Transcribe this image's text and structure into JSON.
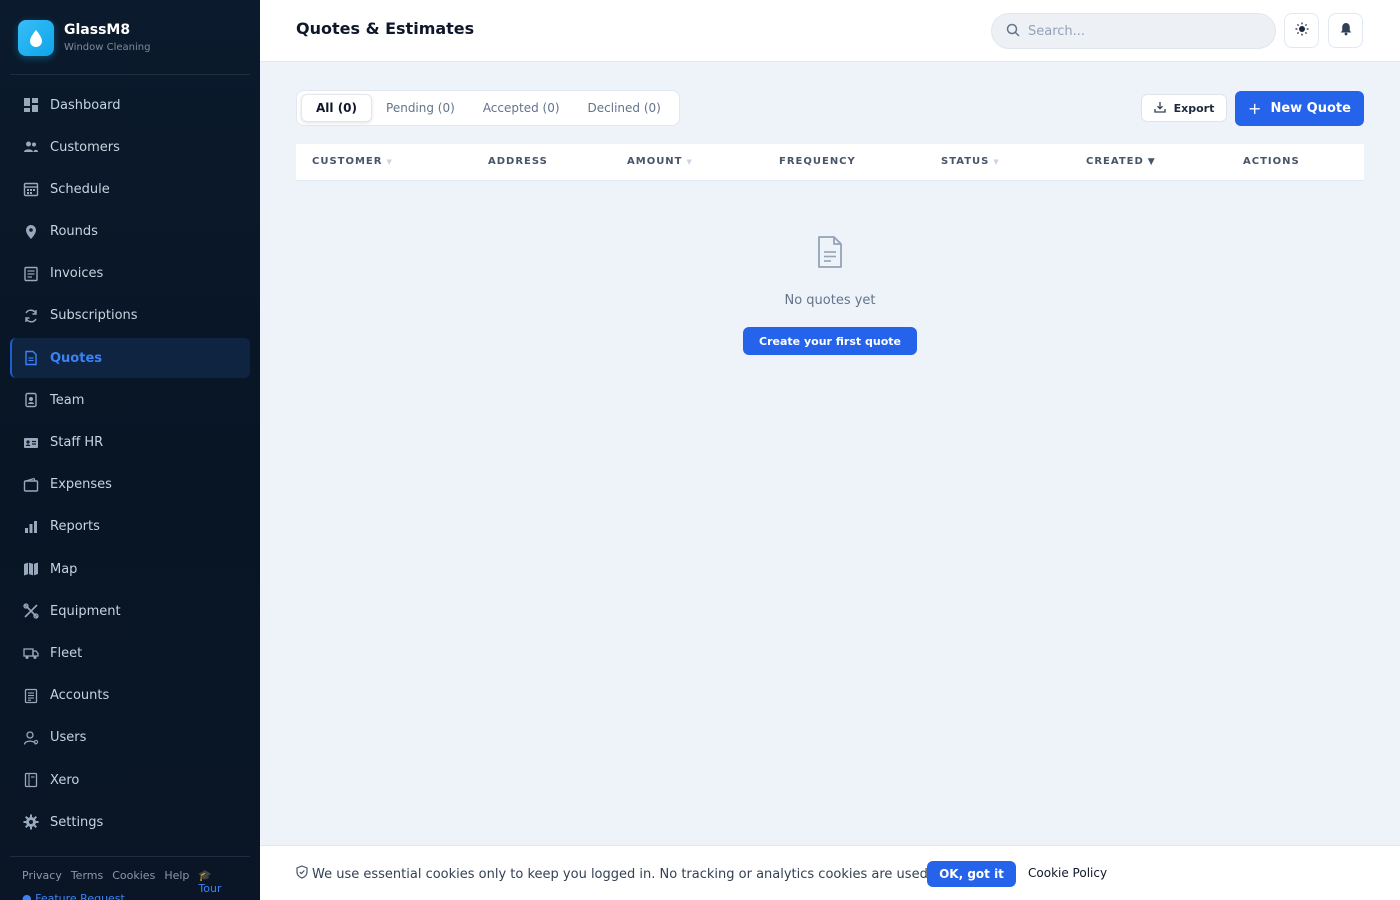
{
  "brand": {
    "name": "GlassM8",
    "subtitle": "Window Cleaning"
  },
  "sidebar": {
    "items": [
      {
        "label": "Dashboard",
        "icon": "dashboard-icon"
      },
      {
        "label": "Customers",
        "icon": "customers-icon"
      },
      {
        "label": "Schedule",
        "icon": "calendar-icon"
      },
      {
        "label": "Rounds",
        "icon": "map-pin-icon"
      },
      {
        "label": "Invoices",
        "icon": "invoice-icon"
      },
      {
        "label": "Subscriptions",
        "icon": "refresh-icon"
      },
      {
        "label": "Quotes",
        "icon": "document-icon",
        "active": true
      },
      {
        "label": "Team",
        "icon": "id-badge-icon"
      },
      {
        "label": "Staff HR",
        "icon": "id-card-icon"
      },
      {
        "label": "Expenses",
        "icon": "wallet-icon"
      },
      {
        "label": "Reports",
        "icon": "bar-chart-icon"
      },
      {
        "label": "Map",
        "icon": "map-icon"
      },
      {
        "label": "Equipment",
        "icon": "tools-icon"
      },
      {
        "label": "Fleet",
        "icon": "truck-icon"
      },
      {
        "label": "Accounts",
        "icon": "ledger-icon"
      },
      {
        "label": "Users",
        "icon": "user-icon"
      },
      {
        "label": "Xero",
        "icon": "book-icon"
      },
      {
        "label": "Settings",
        "icon": "gear-icon"
      }
    ],
    "footer_links": [
      "Privacy",
      "Terms",
      "Cookies",
      "Help"
    ],
    "tour_label": "Tour",
    "feature_request_label": "Feature Request"
  },
  "header": {
    "title": "Quotes & Estimates",
    "search_placeholder": "Search..."
  },
  "tabs": [
    {
      "label": "All (0)",
      "active": true
    },
    {
      "label": "Pending (0)"
    },
    {
      "label": "Accepted (0)"
    },
    {
      "label": "Declined (0)"
    }
  ],
  "actions": {
    "export_label": "Export",
    "new_label": "New Quote"
  },
  "table": {
    "columns": [
      {
        "label": "CUSTOMER",
        "sortable": true
      },
      {
        "label": "ADDRESS",
        "sortable": false
      },
      {
        "label": "AMOUNT",
        "sortable": true
      },
      {
        "label": "FREQUENCY",
        "sortable": false
      },
      {
        "label": "STATUS",
        "sortable": true
      },
      {
        "label": "CREATED",
        "sortable": true,
        "sorted": "desc"
      },
      {
        "label": "ACTIONS",
        "sortable": false
      }
    ],
    "rows": []
  },
  "empty_state": {
    "icon": "document-icon",
    "message": "No quotes yet",
    "cta_label": "Create your first quote"
  },
  "cookie_banner": {
    "message": "We use essential cookies only to keep you logged in. No tracking or analytics cookies are used.",
    "ok_label": "OK, got it",
    "policy_label": "Cookie Policy"
  },
  "colors": {
    "accent": "#2563eb",
    "sidebar_bg": "#0b1a2c",
    "active_nav_text": "#3b82f6",
    "brand_logo": "#0ea5e9"
  }
}
